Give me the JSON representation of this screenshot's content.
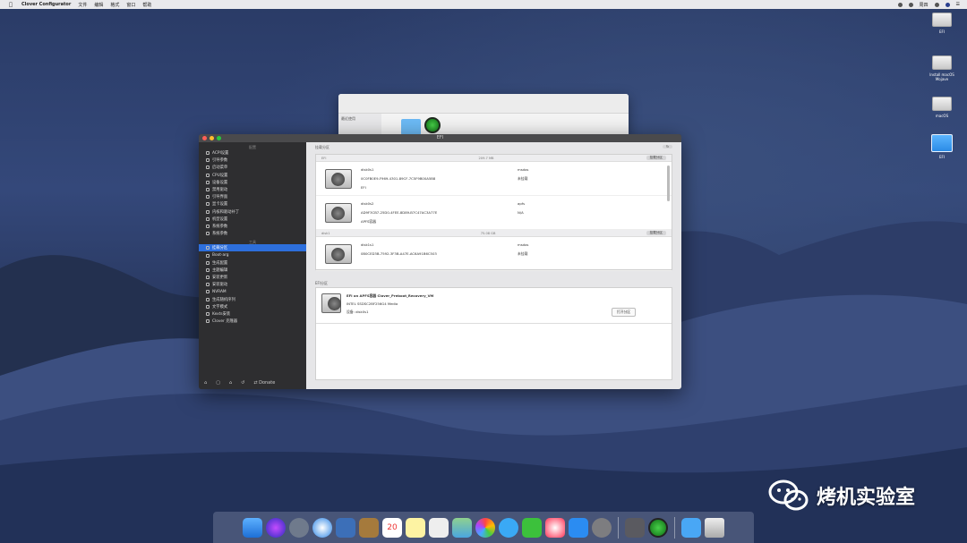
{
  "menubar": {
    "apple": "",
    "app_name": "Clover Configurator",
    "items": [
      "文件",
      "编辑",
      "格式",
      "窗口",
      "帮助"
    ],
    "right_text": "周四"
  },
  "desktop_icons": [
    {
      "label": "EFI"
    },
    {
      "label": "Install macOS Mojave"
    },
    {
      "label": "macOS"
    },
    {
      "label": "EFI"
    }
  ],
  "finder": {
    "sidebar_label": "最近使用"
  },
  "window": {
    "title": "EFI",
    "sidebar_section_1": "配置",
    "sidebar_items": [
      {
        "label": "ACPI设置"
      },
      {
        "label": "引导参数"
      },
      {
        "label": "启动菜单"
      },
      {
        "label": "CPU设置"
      },
      {
        "label": "设备设置"
      },
      {
        "label": "禁用驱动"
      },
      {
        "label": "引导界面"
      },
      {
        "label": "显卡设置"
      },
      {
        "label": "内核和驱动补丁"
      },
      {
        "label": "机型设置"
      },
      {
        "label": "系统参数"
      },
      {
        "label": "系统参数"
      }
    ],
    "sidebar_section_2": "工具",
    "sidebar_tools": [
      {
        "label": "挂载分区",
        "selected": true
      },
      {
        "label": "Boot-arg"
      },
      {
        "label": "生成配置"
      },
      {
        "label": "主题编辑"
      },
      {
        "label": "安装更新"
      },
      {
        "label": "安装驱动"
      },
      {
        "label": "NVRAM"
      },
      {
        "label": "生成随机序列"
      },
      {
        "label": "文字模式"
      },
      {
        "label": "Kexts安装"
      },
      {
        "label": "Clover 克隆器"
      }
    ],
    "bottom_donate": "Donate",
    "mount_section": "挂载分区",
    "mount_group_1": "EFI",
    "mount_button_1": "挂载分区",
    "partitions": [
      {
        "name": "disk0s1",
        "fs": "msdos",
        "uuid": "0C0FB0E9-F969-4301-89CF-7C5F9B00A5B8",
        "type": "EFI",
        "mount": "未挂载"
      },
      {
        "name": "disk0s2",
        "fs": "apfs",
        "uuid": "AD9F3CB7-25D0-4FEE-8D89-B7C47AC3A77E",
        "type": "APFS容器",
        "mount": "N/A"
      },
      {
        "name": "disk1s1",
        "fs": "msdos",
        "uuid": "0B0CED3B-7592-3F3B-A47E-AC6A91B6C503",
        "type": "EFI",
        "mount": "未挂载"
      }
    ],
    "mount_group_2": "disk1",
    "mount_button_2": "挂载分区",
    "size_1": "209.7 MB",
    "size_2": "75.08 GB",
    "efi_section": "EFI分区",
    "efi_title": "EFI on APFS容器 Clover_Preboot_Recovery_VM",
    "efi_disk": "设备: disk0s1",
    "efi_model": "INTEL SSDSC2BF256G4 Media",
    "open_button": "打开分区"
  },
  "watermark": {
    "text": "烤机实验室"
  }
}
